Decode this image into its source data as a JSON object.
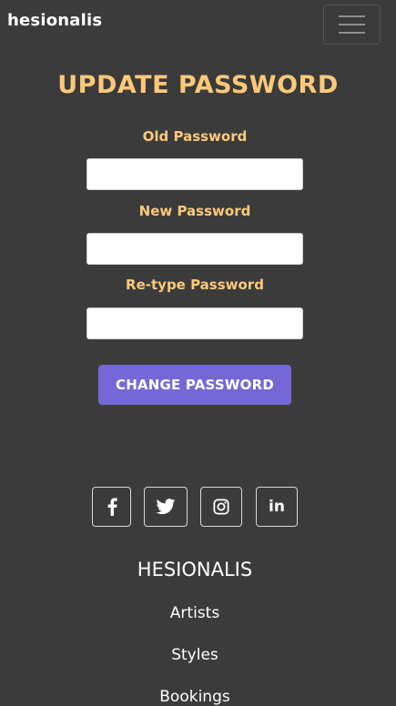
{
  "navbar": {
    "brand": "hesionalis",
    "toggler_icon": "hamburger-menu-icon"
  },
  "form": {
    "title": "UPDATE PASSWORD",
    "old_password_label": "Old Password",
    "old_password_value": "",
    "new_password_label": "New Password",
    "new_password_value": "",
    "retype_password_label": "Re-type Password",
    "retype_password_value": "",
    "submit_label": "CHANGE PASSWORD"
  },
  "footer": {
    "social_icons": [
      "facebook-icon",
      "twitter-icon",
      "instagram-icon",
      "linkedin-icon"
    ],
    "linkedin_glyph": "in",
    "brand": "HESIONALIS",
    "links": [
      "Artists",
      "Styles",
      "Bookings"
    ]
  },
  "colors": {
    "background": "#3b3b3b",
    "accent": "#fcc97a",
    "button": "#7468d6",
    "text": "#ffffff"
  }
}
